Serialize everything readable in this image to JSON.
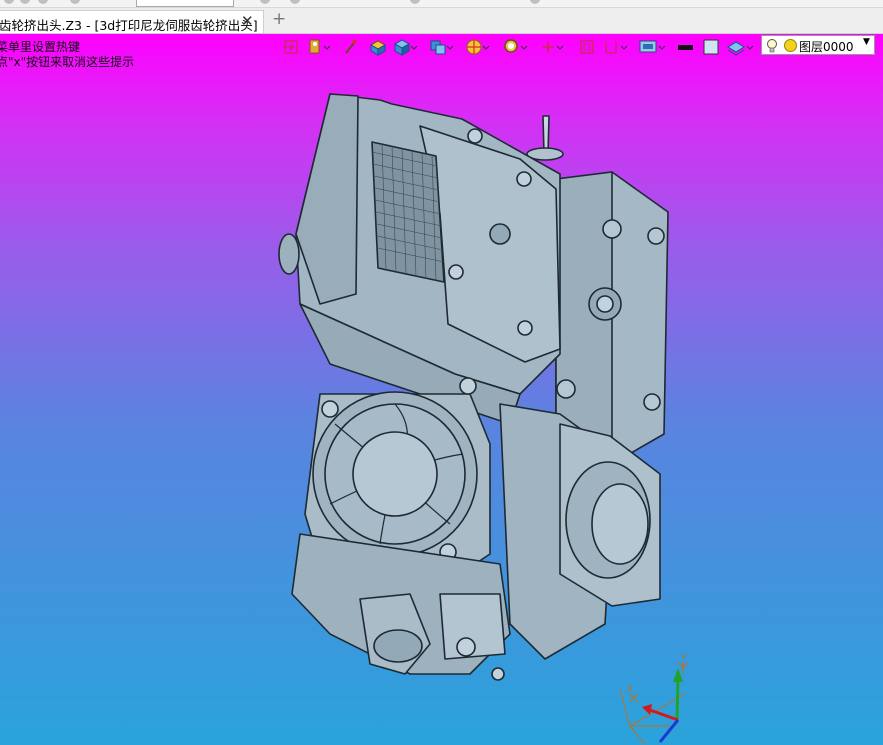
{
  "tab": {
    "title": "齿轮挤出头.Z3 - [3d打印尼龙伺服齿轮挤出头]",
    "close_glyph": "✕",
    "new_tab_glyph": "+"
  },
  "hints": {
    "line1": "菜单里设置热键",
    "line2": "点\"x\"按钮来取消这些提示"
  },
  "toolbar": {
    "icons": [
      "pick-filter-icon",
      "select-mode-icon",
      "brush-icon",
      "part-icon",
      "view-cube-icon",
      "shaded-view-icon",
      "render-mode-icon",
      "view-zoom-icon",
      "axis-icon",
      "frame-icon",
      "align-icon",
      "display-settings-icon",
      "line-color-swatch",
      "fill-color-swatch",
      "layer-style-icon"
    ],
    "line_color": "#111111",
    "fill_color": "#cfe3f5"
  },
  "layer": {
    "label": "图层0000",
    "dot_color": "#f1d31b"
  },
  "axis": {
    "x_label": "X",
    "y_label": "Y"
  },
  "colors": {
    "viewport_top": "#ff00ff",
    "viewport_bottom": "#2aa3db",
    "model_fill": "#a8bcc9",
    "model_dark": "#8aa1b0"
  }
}
